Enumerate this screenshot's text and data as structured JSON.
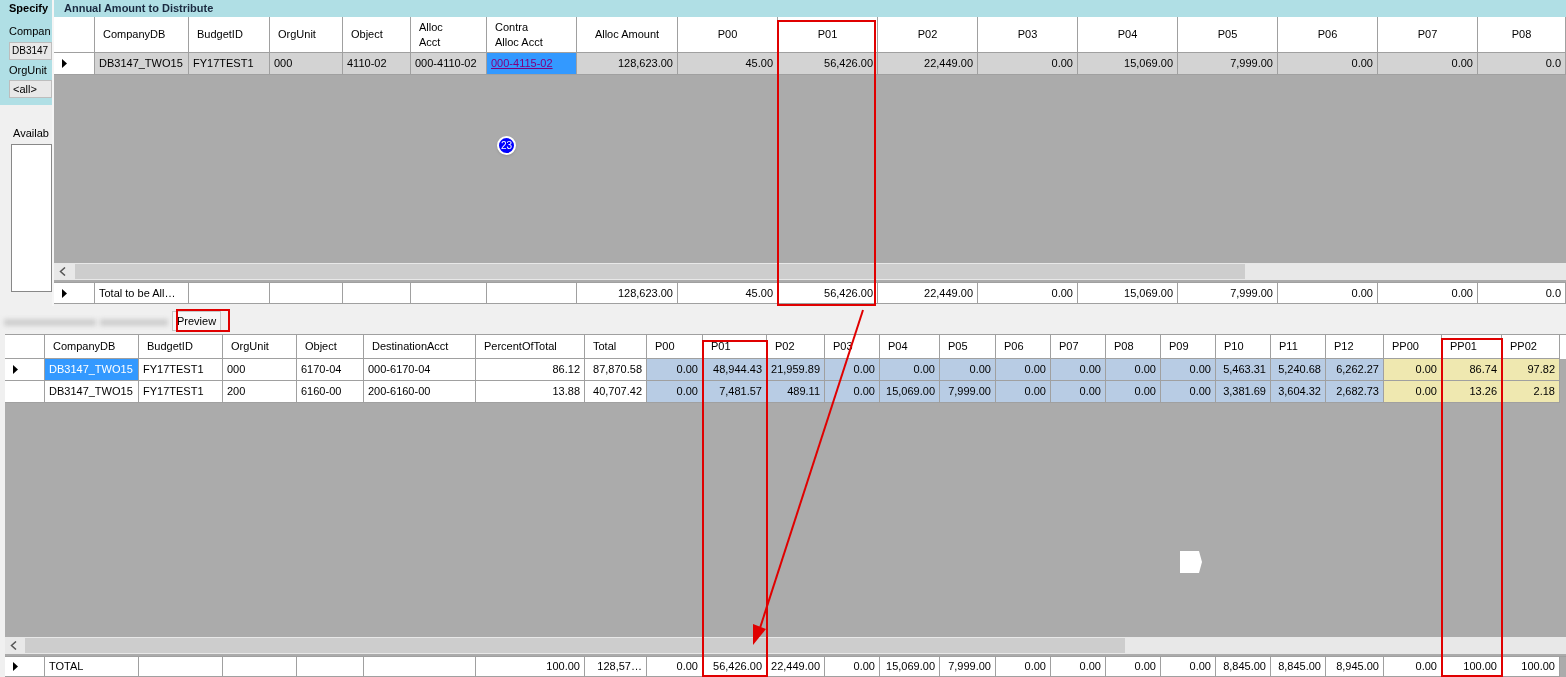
{
  "left_panel": {
    "title": "Specify",
    "company_label": "Compan",
    "company_value": "DB3147",
    "orgunit_label": "OrgUnit",
    "orgunit_value": "<all>",
    "available_label": "Availab"
  },
  "top_grid": {
    "title": "Annual Amount to Distribute",
    "badge": "23",
    "columns": [
      {
        "label": "CompanyDB",
        "kind": "text"
      },
      {
        "label": "BudgetID",
        "kind": "text"
      },
      {
        "label": "OrgUnit",
        "kind": "text"
      },
      {
        "label": "Object",
        "kind": "text"
      },
      {
        "label": "Alloc\nAcct",
        "kind": "text"
      },
      {
        "label": "Contra\nAlloc Acct",
        "kind": "link"
      },
      {
        "label": "Alloc Amount",
        "kind": "number"
      },
      {
        "label": "P00",
        "kind": "number"
      },
      {
        "label": "P01",
        "kind": "number"
      },
      {
        "label": "P02",
        "kind": "number"
      },
      {
        "label": "P03",
        "kind": "number"
      },
      {
        "label": "P04",
        "kind": "number"
      },
      {
        "label": "P05",
        "kind": "number"
      },
      {
        "label": "P06",
        "kind": "number"
      },
      {
        "label": "P07",
        "kind": "number"
      },
      {
        "label": "P08",
        "kind": "number"
      }
    ],
    "rows": [
      {
        "selected": true,
        "cells": [
          "DB3147_TWO15",
          "FY17TEST1",
          "000",
          "4110-02",
          "000-4110-02",
          "000-4115-02",
          "128,623.00",
          "45.00",
          "56,426.00",
          "22,449.00",
          "0.00",
          "15,069.00",
          "7,999.00",
          "0.00",
          "0.00",
          "0.0"
        ]
      }
    ],
    "total": {
      "selected": true,
      "cells": [
        "Total to be All…",
        null,
        null,
        null,
        null,
        null,
        "128,623.00",
        "45.00",
        "56,426.00",
        "22,449.00",
        "0.00",
        "15,069.00",
        "7,999.00",
        "0.00",
        "0.00",
        "0.0"
      ]
    }
  },
  "tabs": [
    {
      "kind": "blurred",
      "selected": false
    },
    {
      "kind": "blurred",
      "selected": false
    },
    {
      "kind": "label",
      "label": "Preview",
      "selected": true
    }
  ],
  "bottom_grid": {
    "columns": [
      {
        "label": "CompanyDB",
        "kind": "text"
      },
      {
        "label": "BudgetID",
        "kind": "text"
      },
      {
        "label": "OrgUnit",
        "kind": "text"
      },
      {
        "label": "Object",
        "kind": "text"
      },
      {
        "label": "DestinationAcct",
        "kind": "text"
      },
      {
        "label": "PercentOfTotal",
        "kind": "number"
      },
      {
        "label": "Total",
        "kind": "number"
      },
      {
        "label": "P00",
        "kind": "period"
      },
      {
        "label": "P01",
        "kind": "period"
      },
      {
        "label": "P02",
        "kind": "period"
      },
      {
        "label": "P03",
        "kind": "period"
      },
      {
        "label": "P04",
        "kind": "period"
      },
      {
        "label": "P05",
        "kind": "period"
      },
      {
        "label": "P06",
        "kind": "period"
      },
      {
        "label": "P07",
        "kind": "period"
      },
      {
        "label": "P08",
        "kind": "period"
      },
      {
        "label": "P09",
        "kind": "period"
      },
      {
        "label": "P10",
        "kind": "period"
      },
      {
        "label": "P11",
        "kind": "period"
      },
      {
        "label": "P12",
        "kind": "period"
      },
      {
        "label": "PP00",
        "kind": "percent"
      },
      {
        "label": "PP01",
        "kind": "percent"
      },
      {
        "label": "PP02",
        "kind": "percent"
      }
    ],
    "rows": [
      {
        "selected": true,
        "cells": [
          "DB3147_TWO15",
          "FY17TEST1",
          "000",
          "6170-04",
          "000-6170-04",
          "86.12",
          "87,870.58",
          "0.00",
          "48,944.43",
          "21,959.89",
          "0.00",
          "0.00",
          "0.00",
          "0.00",
          "0.00",
          "0.00",
          "0.00",
          "5,463.31",
          "5,240.68",
          "6,262.27",
          "0.00",
          "86.74",
          "97.82"
        ]
      },
      {
        "selected": false,
        "cells": [
          "DB3147_TWO15",
          "FY17TEST1",
          "200",
          "6160-00",
          "200-6160-00",
          "13.88",
          "40,707.42",
          "0.00",
          "7,481.57",
          "489.11",
          "0.00",
          "15,069.00",
          "7,999.00",
          "0.00",
          "0.00",
          "0.00",
          "0.00",
          "3,381.69",
          "3,604.32",
          "2,682.73",
          "0.00",
          "13.26",
          "2.18"
        ]
      }
    ],
    "total": {
      "selected": true,
      "cells": [
        "TOTAL",
        null,
        null,
        null,
        null,
        "100.00",
        "128,57…",
        "0.00",
        "56,426.00",
        "22,449.00",
        "0.00",
        "15,069.00",
        "7,999.00",
        "0.00",
        "0.00",
        "0.00",
        "0.00",
        "8,845.00",
        "8,845.00",
        "8,945.00",
        "0.00",
        "100.00",
        "100.00"
      ]
    }
  }
}
